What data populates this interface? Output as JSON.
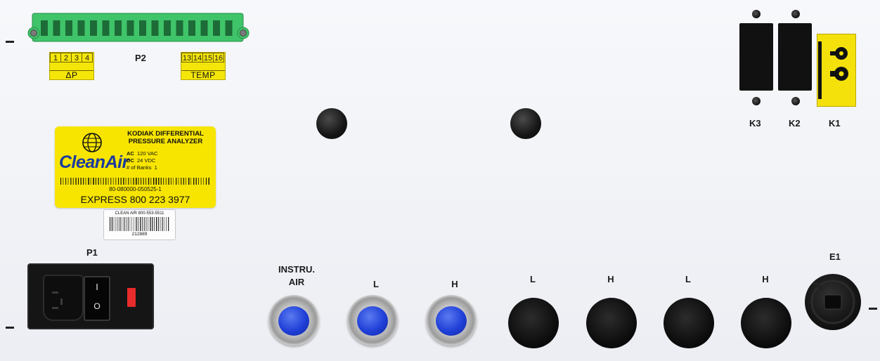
{
  "panel": {
    "p2": {
      "tag": "P2",
      "pins_left": [
        "1",
        "2",
        "3",
        "4"
      ],
      "label_left": "ΔP",
      "pins_right": [
        "13",
        "14",
        "15",
        "16"
      ],
      "label_right": "TEMP"
    },
    "relays": {
      "k3": "K3",
      "k2": "K2",
      "k1": "K1"
    },
    "product_label": {
      "brand": "CleanAir",
      "product_name_line1": "KODIAK DIFFERENTIAL",
      "product_name_line2": "PRESSURE ANALYZER",
      "ac_label": "AC",
      "ac_value": "120 VAC",
      "dc_label": "DC",
      "dc_value": "24 VDC",
      "banks_label": "# of Banks",
      "banks_value": "1",
      "serial": "80-080000-050525-1",
      "express_word": "EXPRESS",
      "express_phone": "800 223 3977",
      "color": "#f7e500"
    },
    "asset_tag": {
      "header": "CLEAN AIR   800-553-5511",
      "number": "212889"
    },
    "power": {
      "tag": "P1",
      "switch_on": "I",
      "switch_off": "O"
    },
    "ports": [
      {
        "label_line1": "INSTRU.",
        "label_line2": "AIR",
        "type": "fitting"
      },
      {
        "label_line1": "L",
        "label_line2": "",
        "type": "fitting"
      },
      {
        "label_line1": "H",
        "label_line2": "",
        "type": "fitting"
      },
      {
        "label_line1": "L",
        "label_line2": "",
        "type": "plug"
      },
      {
        "label_line1": "H",
        "label_line2": "",
        "type": "plug"
      },
      {
        "label_line1": "L",
        "label_line2": "",
        "type": "plug"
      },
      {
        "label_line1": "H",
        "label_line2": "",
        "type": "plug"
      }
    ],
    "e1": {
      "tag": "E1"
    },
    "colors": {
      "terminal_green": "#3fc46a",
      "fitting_cap_blue": "#2040d8",
      "fuse_red": "#e82b2b",
      "k1_yellow": "#f4e10c"
    }
  }
}
